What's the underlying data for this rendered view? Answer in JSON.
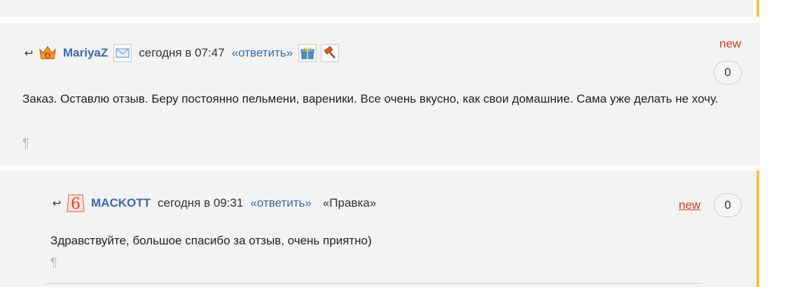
{
  "comments": [
    {
      "author": "MariyaZ",
      "time": "сегодня в 07:47",
      "reply": "«ответить»",
      "new_label": "new",
      "count": "0",
      "text": "Заказ. Оставлю отзыв. Беру постоянно пельмени, вареники. Все очень вкусно, как свои домашние. Сама уже делать не хочу.",
      "pilcrow": "¶",
      "icons": [
        "crown-avatar-icon",
        "mail-icon",
        "gift-icon",
        "hammer-icon"
      ]
    },
    {
      "author": "MACKOTT",
      "time": "сегодня в 09:31",
      "reply": "«ответить»",
      "edit": "«Правка»",
      "new_label": "new",
      "count": "0",
      "text": "Здравствуйте, большое спасибо за отзыв, очень приятно)",
      "pilcrow": "¶",
      "icons": [
        "badge-6-avatar-icon"
      ]
    }
  ],
  "colors": {
    "background": "#f3f3f3",
    "link": "#3a6aa8",
    "new": "#d33a1f",
    "accent_bar": "#f5c242"
  }
}
